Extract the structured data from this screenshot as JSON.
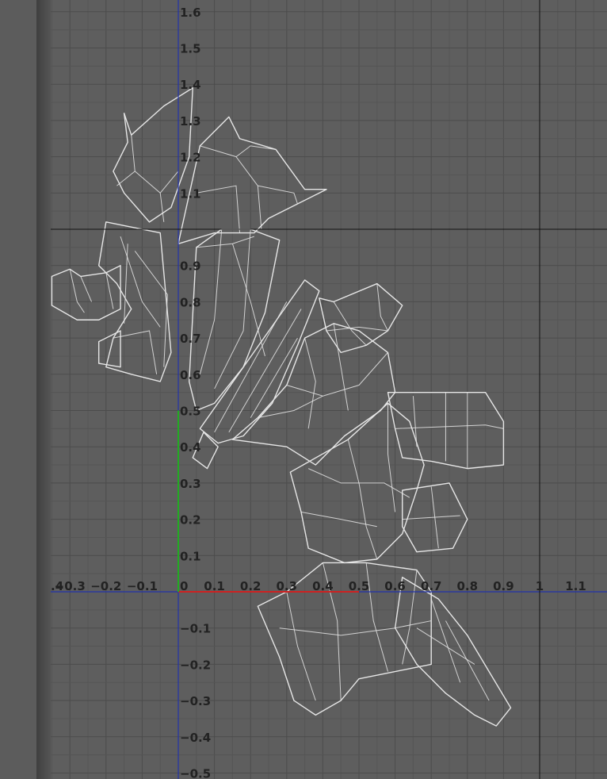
{
  "editor": {
    "view": "uv-editor-viewport",
    "colors": {
      "background": "#5e5e5e",
      "grid_minor": "#555555",
      "grid_major": "#4c4c4c",
      "u_axis": "#cc2222",
      "v_axis": "#22aa22",
      "origin_lines": "#2233aa",
      "boundary_lines": "#111111",
      "wireframe": "#e6e6e6",
      "labels": "#222222"
    }
  },
  "axes": {
    "u_ticks": [
      {
        "value": -0.4,
        "label": ".4"
      },
      {
        "value": -0.3,
        "label": "−0.3"
      },
      {
        "value": -0.2,
        "label": "−0.2"
      },
      {
        "value": -0.1,
        "label": "−0.1"
      },
      {
        "value": 0,
        "label": "0"
      },
      {
        "value": 0.1,
        "label": "0.1"
      },
      {
        "value": 0.2,
        "label": "0.2"
      },
      {
        "value": 0.3,
        "label": "0.3"
      },
      {
        "value": 0.4,
        "label": "0.4"
      },
      {
        "value": 0.5,
        "label": "0.5"
      },
      {
        "value": 0.6,
        "label": "0.6"
      },
      {
        "value": 0.7,
        "label": "0.7"
      },
      {
        "value": 0.8,
        "label": "0.8"
      },
      {
        "value": 0.9,
        "label": "0.9"
      },
      {
        "value": 1,
        "label": "1"
      },
      {
        "value": 1.1,
        "label": "1.1"
      }
    ],
    "v_ticks": [
      {
        "value": 1.6,
        "label": "1.6"
      },
      {
        "value": 1.5,
        "label": "1.5"
      },
      {
        "value": 1.4,
        "label": "1.4"
      },
      {
        "value": 1.3,
        "label": "1.3"
      },
      {
        "value": 1.2,
        "label": "1.2"
      },
      {
        "value": 1.1,
        "label": "1.1"
      },
      {
        "value": 0.9,
        "label": "0.9"
      },
      {
        "value": 0.8,
        "label": "0.8"
      },
      {
        "value": 0.7,
        "label": "0.7"
      },
      {
        "value": 0.6,
        "label": "0.6"
      },
      {
        "value": 0.5,
        "label": "0.5"
      },
      {
        "value": 0.4,
        "label": "0.4"
      },
      {
        "value": 0.3,
        "label": "0.3"
      },
      {
        "value": 0.2,
        "label": "0.2"
      },
      {
        "value": 0.1,
        "label": "0.1"
      },
      {
        "value": -0.1,
        "label": "−0.1"
      },
      {
        "value": -0.2,
        "label": "−0.2"
      },
      {
        "value": -0.3,
        "label": "−0.3"
      },
      {
        "value": -0.4,
        "label": "−0.4"
      },
      {
        "value": -0.5,
        "label": "−0.5"
      }
    ],
    "u_range": [
      -0.4,
      1.2
    ],
    "v_range": [
      -0.5,
      1.6
    ]
  },
  "uv_islands": [
    {
      "name": "island-top-left",
      "outline": [
        [
          -0.15,
          1.32
        ],
        [
          -0.13,
          1.26
        ],
        [
          -0.04,
          1.34
        ],
        [
          0.04,
          1.39
        ],
        [
          0.03,
          1.2
        ],
        [
          -0.02,
          1.06
        ],
        [
          -0.08,
          1.02
        ],
        [
          -0.15,
          1.1
        ],
        [
          -0.18,
          1.16
        ],
        [
          -0.14,
          1.24
        ]
      ],
      "inner": [
        [
          [
            -0.13,
            1.26
          ],
          [
            -0.12,
            1.16
          ],
          [
            -0.05,
            1.1
          ],
          [
            0.0,
            1.16
          ],
          [
            0.0,
            1.3
          ]
        ],
        [
          [
            -0.12,
            1.16
          ],
          [
            -0.17,
            1.12
          ]
        ],
        [
          [
            -0.05,
            1.1
          ],
          [
            -0.04,
            1.02
          ]
        ]
      ]
    },
    {
      "name": "island-spike-upper",
      "outline": [
        [
          0.0,
          0.96
        ],
        [
          0.06,
          1.23
        ],
        [
          0.14,
          1.31
        ],
        [
          0.17,
          1.25
        ],
        [
          0.27,
          1.22
        ],
        [
          0.35,
          1.11
        ],
        [
          0.41,
          1.11
        ],
        [
          0.33,
          1.07
        ],
        [
          0.25,
          1.03
        ],
        [
          0.21,
          0.99
        ],
        [
          0.1,
          0.99
        ]
      ],
      "inner": [
        [
          [
            0.06,
            1.23
          ],
          [
            0.16,
            1.2
          ],
          [
            0.22,
            1.12
          ],
          [
            0.23,
            1.0
          ]
        ],
        [
          [
            0.16,
            1.2
          ],
          [
            0.2,
            1.23
          ],
          [
            0.27,
            1.22
          ]
        ],
        [
          [
            0.22,
            1.12
          ],
          [
            0.32,
            1.1
          ],
          [
            0.33,
            1.07
          ]
        ],
        [
          [
            0.05,
            1.1
          ],
          [
            0.16,
            1.12
          ],
          [
            0.17,
            0.99
          ]
        ]
      ]
    },
    {
      "name": "island-left-chunk",
      "outline": [
        [
          -0.2,
          1.02
        ],
        [
          -0.05,
          0.99
        ],
        [
          -0.02,
          0.66
        ],
        [
          -0.05,
          0.58
        ],
        [
          -0.13,
          0.6
        ],
        [
          -0.2,
          0.62
        ],
        [
          -0.18,
          0.7
        ],
        [
          -0.13,
          0.78
        ],
        [
          -0.17,
          0.85
        ],
        [
          -0.22,
          0.9
        ]
      ],
      "inner": [
        [
          [
            -0.16,
            0.98
          ],
          [
            -0.1,
            0.8
          ],
          [
            -0.05,
            0.73
          ]
        ],
        [
          [
            -0.12,
            0.94
          ],
          [
            -0.03,
            0.82
          ],
          [
            -0.04,
            0.62
          ]
        ],
        [
          [
            -0.18,
            0.7
          ],
          [
            -0.08,
            0.72
          ],
          [
            -0.06,
            0.6
          ]
        ],
        [
          [
            -0.14,
            0.96
          ],
          [
            -0.15,
            0.74
          ]
        ]
      ]
    },
    {
      "name": "island-far-left",
      "outline": [
        [
          -0.35,
          0.87
        ],
        [
          -0.3,
          0.89
        ],
        [
          -0.27,
          0.87
        ],
        [
          -0.2,
          0.88
        ],
        [
          -0.16,
          0.9
        ],
        [
          -0.16,
          0.78
        ],
        [
          -0.22,
          0.75
        ],
        [
          -0.28,
          0.75
        ],
        [
          -0.35,
          0.79
        ]
      ],
      "inner": [
        [
          [
            -0.3,
            0.89
          ],
          [
            -0.28,
            0.8
          ],
          [
            -0.26,
            0.77
          ]
        ],
        [
          [
            -0.27,
            0.87
          ],
          [
            -0.24,
            0.8
          ]
        ],
        [
          [
            -0.2,
            0.88
          ],
          [
            -0.18,
            0.78
          ]
        ]
      ]
    },
    {
      "name": "island-spike-center",
      "outline": [
        [
          0.03,
          0.58
        ],
        [
          0.05,
          0.95
        ],
        [
          0.12,
          1.0
        ],
        [
          0.2,
          1.0
        ],
        [
          0.28,
          0.97
        ],
        [
          0.24,
          0.77
        ],
        [
          0.18,
          0.62
        ],
        [
          0.1,
          0.52
        ],
        [
          0.05,
          0.5
        ]
      ],
      "inner": [
        [
          [
            0.05,
            0.95
          ],
          [
            0.15,
            0.96
          ],
          [
            0.21,
            0.98
          ]
        ],
        [
          [
            0.12,
            1.0
          ],
          [
            0.1,
            0.75
          ],
          [
            0.06,
            0.6
          ]
        ],
        [
          [
            0.2,
            1.0
          ],
          [
            0.18,
            0.72
          ],
          [
            0.1,
            0.56
          ]
        ],
        [
          [
            0.15,
            0.96
          ],
          [
            0.2,
            0.8
          ],
          [
            0.24,
            0.65
          ]
        ]
      ]
    },
    {
      "name": "island-long-diagonal",
      "outline": [
        [
          0.06,
          0.45
        ],
        [
          0.35,
          0.86
        ],
        [
          0.39,
          0.83
        ],
        [
          0.33,
          0.68
        ],
        [
          0.26,
          0.52
        ],
        [
          0.18,
          0.43
        ],
        [
          0.11,
          0.41
        ]
      ],
      "inner": [
        [
          [
            0.1,
            0.44
          ],
          [
            0.3,
            0.8
          ]
        ],
        [
          [
            0.14,
            0.44
          ],
          [
            0.34,
            0.78
          ]
        ],
        [
          [
            0.2,
            0.48
          ],
          [
            0.33,
            0.7
          ]
        ]
      ]
    },
    {
      "name": "island-center-large",
      "outline": [
        [
          0.15,
          0.42
        ],
        [
          0.3,
          0.4
        ],
        [
          0.38,
          0.35
        ],
        [
          0.46,
          0.43
        ],
        [
          0.56,
          0.5
        ],
        [
          0.6,
          0.55
        ],
        [
          0.58,
          0.66
        ],
        [
          0.5,
          0.72
        ],
        [
          0.43,
          0.74
        ],
        [
          0.35,
          0.7
        ],
        [
          0.3,
          0.57
        ],
        [
          0.22,
          0.48
        ]
      ],
      "inner": [
        [
          [
            0.3,
            0.57
          ],
          [
            0.4,
            0.54
          ],
          [
            0.5,
            0.57
          ],
          [
            0.58,
            0.66
          ]
        ],
        [
          [
            0.35,
            0.7
          ],
          [
            0.38,
            0.58
          ],
          [
            0.36,
            0.45
          ]
        ],
        [
          [
            0.43,
            0.74
          ],
          [
            0.45,
            0.62
          ],
          [
            0.47,
            0.5
          ]
        ],
        [
          [
            0.22,
            0.48
          ],
          [
            0.32,
            0.5
          ],
          [
            0.4,
            0.54
          ]
        ]
      ]
    },
    {
      "name": "island-upper-right-box",
      "outline": [
        [
          0.39,
          0.81
        ],
        [
          0.43,
          0.8
        ],
        [
          0.55,
          0.85
        ],
        [
          0.62,
          0.79
        ],
        [
          0.58,
          0.72
        ],
        [
          0.52,
          0.68
        ],
        [
          0.45,
          0.66
        ],
        [
          0.41,
          0.72
        ]
      ],
      "inner": [
        [
          [
            0.43,
            0.8
          ],
          [
            0.48,
            0.72
          ],
          [
            0.52,
            0.68
          ]
        ],
        [
          [
            0.55,
            0.85
          ],
          [
            0.56,
            0.76
          ],
          [
            0.58,
            0.72
          ]
        ],
        [
          [
            0.41,
            0.72
          ],
          [
            0.5,
            0.73
          ],
          [
            0.58,
            0.72
          ]
        ]
      ]
    },
    {
      "name": "island-right-arm",
      "outline": [
        [
          0.58,
          0.55
        ],
        [
          0.66,
          0.55
        ],
        [
          0.85,
          0.55
        ],
        [
          0.9,
          0.47
        ],
        [
          0.9,
          0.35
        ],
        [
          0.8,
          0.34
        ],
        [
          0.7,
          0.36
        ],
        [
          0.62,
          0.37
        ],
        [
          0.6,
          0.45
        ]
      ],
      "inner": [
        [
          [
            0.65,
            0.54
          ],
          [
            0.66,
            0.4
          ]
        ],
        [
          [
            0.74,
            0.55
          ],
          [
            0.74,
            0.36
          ]
        ],
        [
          [
            0.8,
            0.55
          ],
          [
            0.8,
            0.34
          ]
        ],
        [
          [
            0.6,
            0.45
          ],
          [
            0.85,
            0.46
          ],
          [
            0.9,
            0.45
          ]
        ]
      ]
    },
    {
      "name": "island-middle-block",
      "outline": [
        [
          0.31,
          0.33
        ],
        [
          0.47,
          0.42
        ],
        [
          0.58,
          0.52
        ],
        [
          0.64,
          0.47
        ],
        [
          0.68,
          0.35
        ],
        [
          0.66,
          0.28
        ],
        [
          0.62,
          0.16
        ],
        [
          0.55,
          0.09
        ],
        [
          0.46,
          0.08
        ],
        [
          0.36,
          0.12
        ],
        [
          0.34,
          0.22
        ]
      ],
      "inner": [
        [
          [
            0.36,
            0.34
          ],
          [
            0.45,
            0.3
          ],
          [
            0.57,
            0.3
          ],
          [
            0.64,
            0.26
          ]
        ],
        [
          [
            0.47,
            0.42
          ],
          [
            0.5,
            0.3
          ],
          [
            0.52,
            0.18
          ],
          [
            0.55,
            0.09
          ]
        ],
        [
          [
            0.58,
            0.52
          ],
          [
            0.58,
            0.38
          ],
          [
            0.6,
            0.22
          ]
        ],
        [
          [
            0.34,
            0.22
          ],
          [
            0.45,
            0.2
          ],
          [
            0.55,
            0.18
          ]
        ]
      ]
    },
    {
      "name": "island-right-small",
      "outline": [
        [
          0.62,
          0.28
        ],
        [
          0.75,
          0.3
        ],
        [
          0.8,
          0.2
        ],
        [
          0.76,
          0.12
        ],
        [
          0.66,
          0.11
        ],
        [
          0.62,
          0.18
        ]
      ],
      "inner": [
        [
          [
            0.7,
            0.29
          ],
          [
            0.72,
            0.12
          ]
        ],
        [
          [
            0.62,
            0.2
          ],
          [
            0.78,
            0.21
          ]
        ]
      ]
    },
    {
      "name": "island-bottom-wedge",
      "outline": [
        [
          0.22,
          -0.04
        ],
        [
          0.3,
          0.0
        ],
        [
          0.4,
          0.08
        ],
        [
          0.52,
          0.08
        ],
        [
          0.66,
          0.06
        ],
        [
          0.7,
          0.0
        ],
        [
          0.7,
          -0.2
        ],
        [
          0.6,
          -0.22
        ],
        [
          0.5,
          -0.24
        ],
        [
          0.45,
          -0.3
        ],
        [
          0.38,
          -0.34
        ],
        [
          0.32,
          -0.3
        ],
        [
          0.28,
          -0.18
        ]
      ],
      "inner": [
        [
          [
            0.3,
            0.0
          ],
          [
            0.33,
            -0.15
          ],
          [
            0.38,
            -0.3
          ]
        ],
        [
          [
            0.4,
            0.08
          ],
          [
            0.44,
            -0.08
          ],
          [
            0.45,
            -0.3
          ]
        ],
        [
          [
            0.52,
            0.08
          ],
          [
            0.54,
            -0.08
          ],
          [
            0.58,
            -0.22
          ]
        ],
        [
          [
            0.66,
            0.06
          ],
          [
            0.64,
            -0.1
          ],
          [
            0.62,
            -0.2
          ]
        ],
        [
          [
            0.28,
            -0.1
          ],
          [
            0.45,
            -0.12
          ],
          [
            0.6,
            -0.1
          ],
          [
            0.7,
            -0.08
          ]
        ]
      ]
    },
    {
      "name": "island-bottom-right-tail",
      "outline": [
        [
          0.62,
          0.04
        ],
        [
          0.72,
          -0.02
        ],
        [
          0.8,
          -0.12
        ],
        [
          0.92,
          -0.32
        ],
        [
          0.88,
          -0.37
        ],
        [
          0.82,
          -0.34
        ],
        [
          0.74,
          -0.28
        ],
        [
          0.66,
          -0.2
        ],
        [
          0.6,
          -0.1
        ]
      ],
      "inner": [
        [
          [
            0.7,
            -0.02
          ],
          [
            0.78,
            -0.25
          ]
        ],
        [
          [
            0.74,
            -0.08
          ],
          [
            0.86,
            -0.3
          ]
        ],
        [
          [
            0.66,
            -0.1
          ],
          [
            0.82,
            -0.2
          ]
        ]
      ]
    },
    {
      "name": "island-tiny-left",
      "outline": [
        [
          -0.22,
          0.69
        ],
        [
          -0.16,
          0.72
        ],
        [
          -0.16,
          0.62
        ],
        [
          -0.22,
          0.63
        ]
      ],
      "inner": []
    },
    {
      "name": "island-tiny-center",
      "outline": [
        [
          0.07,
          0.44
        ],
        [
          0.11,
          0.4
        ],
        [
          0.08,
          0.34
        ],
        [
          0.04,
          0.37
        ]
      ],
      "inner": []
    }
  ]
}
